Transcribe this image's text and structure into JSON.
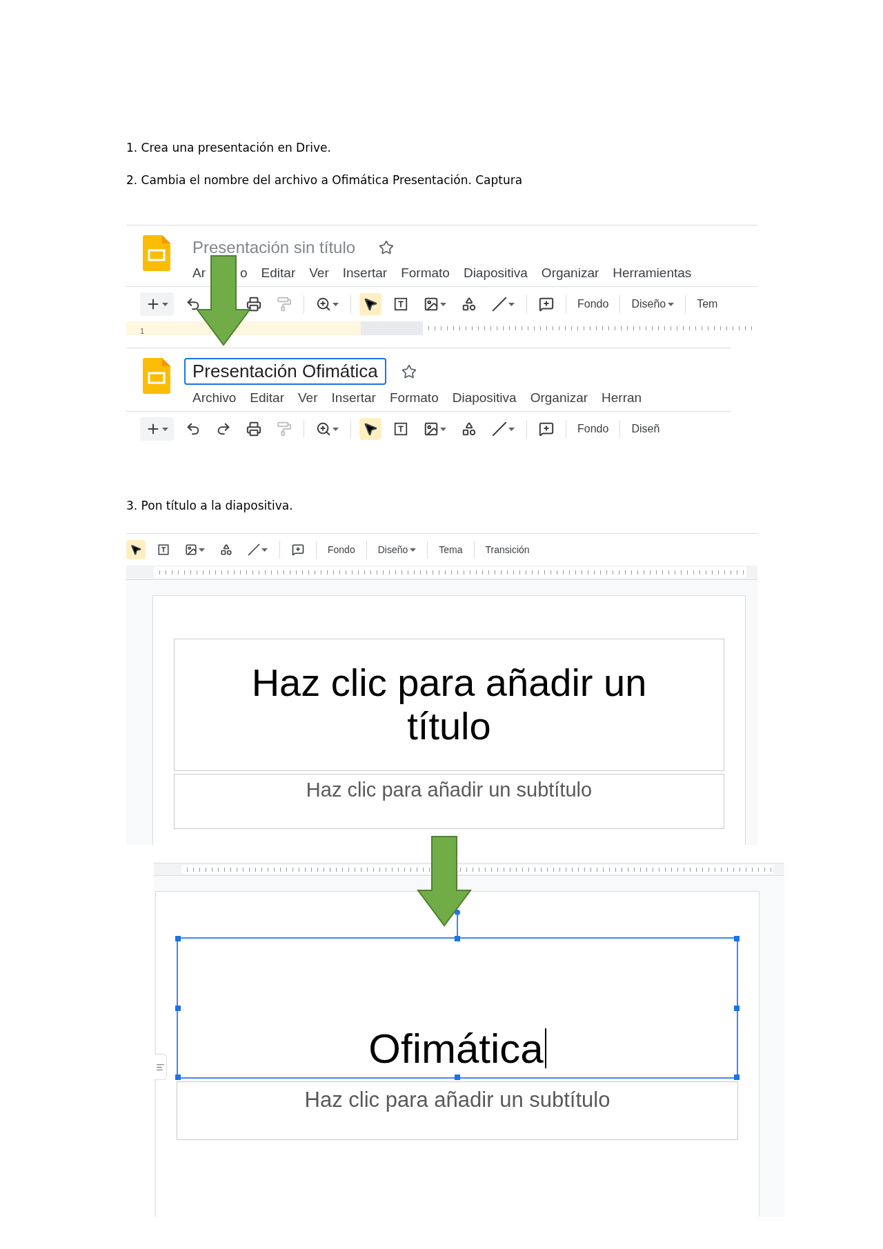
{
  "steps": [
    {
      "text": "1. Crea una presentación en Drive."
    },
    {
      "text": "2. Cambia el nombre del archivo a Ofimática Presentación. Captura"
    }
  ],
  "header_captures": [
    {
      "title": "Presentación sin título",
      "editing": false,
      "menus": [
        [
          "Ar",
          "o"
        ],
        [
          "Editar"
        ],
        [
          "Ver"
        ],
        [
          "Insertar"
        ],
        [
          "Formato"
        ],
        [
          "Diapositiva"
        ],
        [
          "Organizar"
        ],
        [
          "Herramientas"
        ]
      ],
      "pointer_selected": true,
      "buttons": [
        {
          "label": "Fondo",
          "dropdown": false
        },
        {
          "label": "Diseño",
          "dropdown": true
        },
        {
          "label": "Tem",
          "dropdown": false
        }
      ],
      "slide_number": "1"
    },
    {
      "title": "Presentación Ofimática",
      "editing": true,
      "menus": [
        [
          "Archivo"
        ],
        [
          "Editar"
        ],
        [
          "Ver"
        ],
        [
          "Insertar"
        ],
        [
          "Formato"
        ],
        [
          "Diapositiva"
        ],
        [
          "Organizar"
        ],
        [
          "Herran"
        ]
      ],
      "pointer_selected": true,
      "buttons": [
        {
          "label": "Fondo",
          "dropdown": false
        },
        {
          "label": "Diseñ",
          "dropdown": false
        }
      ]
    }
  ],
  "step_3": "3. Pon título a la diapositiva.",
  "slide_captures": [
    {
      "toolbar": {
        "pointer_selected": true,
        "buttons": [
          {
            "label": "Fondo",
            "dropdown": false
          },
          {
            "label": "Diseño",
            "dropdown": true
          },
          {
            "label": "Tema",
            "dropdown": false
          },
          {
            "label": "Transición",
            "dropdown": false
          }
        ]
      },
      "title": "Haz clic para añadir un título",
      "title_selected": false,
      "subtitle": "Haz clic para añadir un subtítulo"
    },
    {
      "title": "Ofimática",
      "title_selected": true,
      "subtitle": "Haz clic para añadir un subtítulo"
    }
  ]
}
